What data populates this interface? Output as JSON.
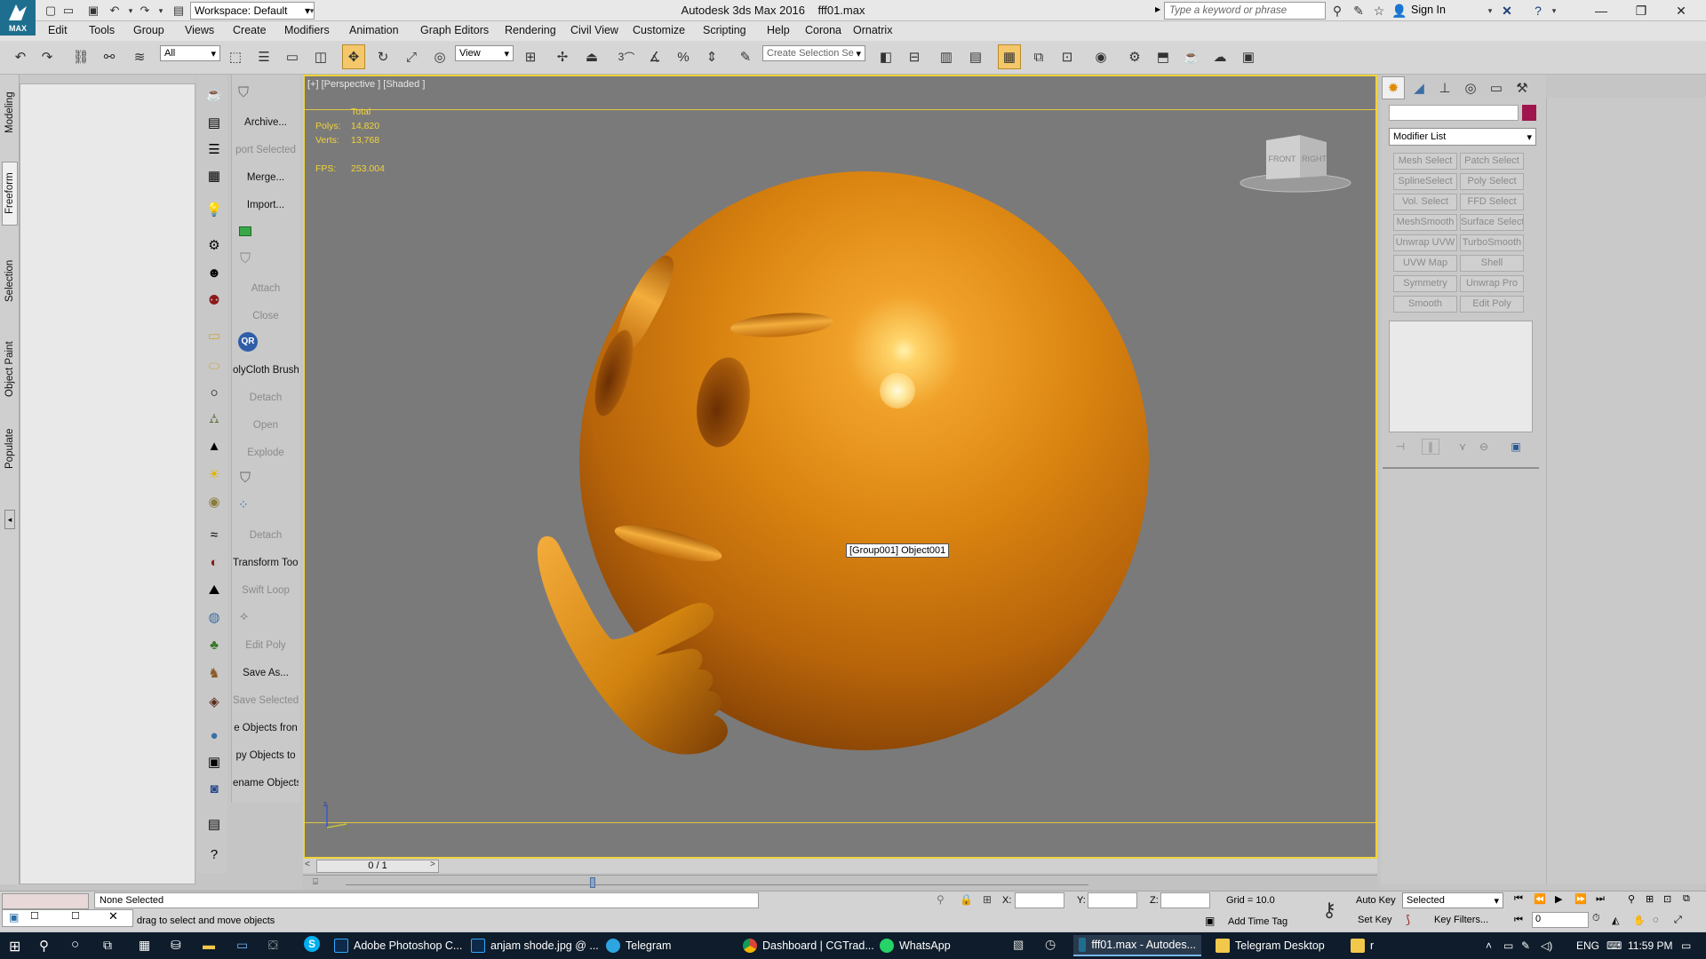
{
  "titlebar": {
    "logo": "MAX",
    "workspace": "Workspace: Default",
    "title": "Autodesk 3ds Max 2016",
    "file": "fff01.max",
    "search_placeholder": "Type a keyword or phrase",
    "signin": "Sign In"
  },
  "menu": [
    "Edit",
    "Tools",
    "Group",
    "Views",
    "Create",
    "Modifiers",
    "Animation",
    "Graph Editors",
    "Rendering",
    "Civil View",
    "Customize",
    "Scripting",
    "Help",
    "Corona",
    "Ornatrix"
  ],
  "toolbar": {
    "filter": "All",
    "refcoord": "View",
    "selset": "Create Selection Se",
    "snap_label": "3"
  },
  "lefttabs": [
    "Modeling",
    "Freeform",
    "Selection",
    "Object Paint",
    "Populate"
  ],
  "commands": [
    {
      "label": "Archive...",
      "dim": false
    },
    {
      "label": "port Selected",
      "dim": true
    },
    {
      "label": "Merge...",
      "dim": false
    },
    {
      "label": "Import...",
      "dim": false
    },
    {
      "label": "",
      "dim": false
    },
    {
      "label": "",
      "dim": false
    },
    {
      "label": "Attach",
      "dim": true
    },
    {
      "label": "Close",
      "dim": true
    },
    {
      "label": "",
      "dim": false
    },
    {
      "label": "olyCloth Brush",
      "dim": false
    },
    {
      "label": "Detach",
      "dim": true
    },
    {
      "label": "Open",
      "dim": true
    },
    {
      "label": "Explode",
      "dim": true
    },
    {
      "label": "",
      "dim": false
    },
    {
      "label": "",
      "dim": false
    },
    {
      "label": "Detach",
      "dim": true
    },
    {
      "label": "Transform Tool",
      "dim": false
    },
    {
      "label": "Swift Loop",
      "dim": true
    },
    {
      "label": "",
      "dim": false
    },
    {
      "label": "Edit Poly",
      "dim": true
    },
    {
      "label": "Save As...",
      "dim": false
    },
    {
      "label": "Save Selected",
      "dim": true
    },
    {
      "label": "e Objects fron",
      "dim": false
    },
    {
      "label": "py Objects to",
      "dim": false
    },
    {
      "label": "ename Objects",
      "dim": false
    }
  ],
  "viewport": {
    "label": "[+] [Perspective ] [Shaded ]",
    "stats_header": "Total",
    "polys_label": "Polys:",
    "polys": "14,820",
    "verts_label": "Verts:",
    "verts": "13,768",
    "fps_label": "FPS:",
    "fps": "253.004",
    "tooltip": "[Group001] Object001",
    "cube_front": "FRONT",
    "cube_right": "RIGHT",
    "axis_z": "z",
    "axis_x": "x"
  },
  "panel": {
    "modifier_list": "Modifier List",
    "swatch_color": "#a0144e",
    "modifiers": [
      "Mesh Select",
      "Patch Select",
      "SplineSelect",
      "Poly Select",
      "Vol. Select",
      "FFD Select",
      "MeshSmooth",
      "Surface Select",
      "Unwrap UVW",
      "TurboSmooth",
      "UVW Map",
      "Shell",
      "Symmetry",
      "Unwrap Pro",
      "Smooth",
      "Edit Poly"
    ]
  },
  "timeline": {
    "frame": "0 / 1"
  },
  "status": {
    "selected": "None Selected",
    "prompt": "drag to select and move objects",
    "x_label": "X:",
    "y_label": "Y:",
    "z_label": "Z:",
    "grid": "Grid = 10.0",
    "addtimetag": "Add Time Tag",
    "autokey": "Auto Key",
    "setkey": "Set Key",
    "keymode": "Selected",
    "keyfilters": "Key Filters...",
    "frame": "0"
  },
  "taskbar": {
    "apps": [
      "Adobe Photoshop C...",
      "anjam shode.jpg @ ...",
      "Telegram",
      "Dashboard | CGTrad...",
      "WhatsApp",
      "fff01.max - Autodes...",
      "Telegram Desktop",
      "r"
    ],
    "lang": "ENG",
    "time": "11:59 PM"
  }
}
